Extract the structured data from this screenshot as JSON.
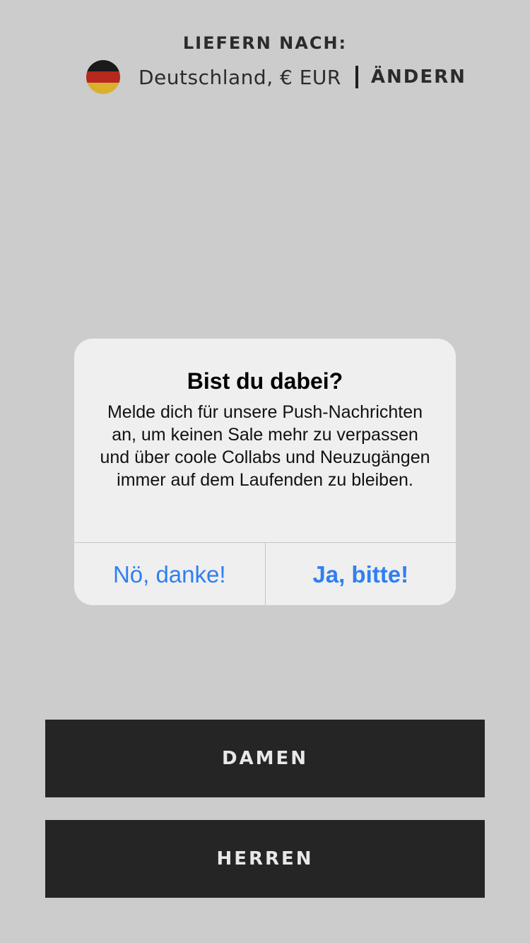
{
  "shipping": {
    "title": "LIEFERN NACH:",
    "country": "Deutschland, € EUR",
    "change_label": "ÄNDERN",
    "flag_colors": [
      "#000000",
      "#dd0000",
      "#ffce00"
    ]
  },
  "alert": {
    "title": "Bist du dabei?",
    "message": "Melde dich für unsere Push-Nachrichten an, um keinen Sale mehr zu verpassen und über coole Collabs und Neuzugängen immer auf dem Laufenden zu bleiben.",
    "decline_label": "Nö, danke!",
    "accept_label": "Ja, bitte!",
    "button_color": "#2f7ff0"
  },
  "categories": {
    "women_label": "DAMEN",
    "men_label": "HERREN"
  }
}
